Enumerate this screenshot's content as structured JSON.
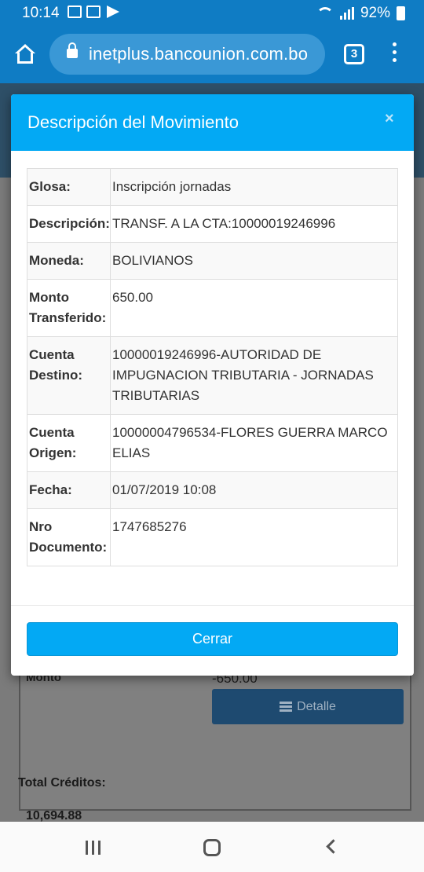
{
  "status_bar": {
    "time": "10:14",
    "battery": "92%",
    "notification_icons": [
      "image-icon",
      "mail-icon",
      "telegram-icon"
    ]
  },
  "browser": {
    "url": "inetplus.bancounion.com.bo",
    "tab_count": "3"
  },
  "modal": {
    "title": "Descripción del Movimiento",
    "close_label": "×",
    "rows": [
      {
        "label": "Glosa:",
        "value": "Inscripción jornadas"
      },
      {
        "label": "Descripción:",
        "value": "TRANSF. A LA CTA:10000019246996"
      },
      {
        "label": "Moneda:",
        "value": "BOLIVIANOS"
      },
      {
        "label": "Monto Transferido:",
        "value": "650.00"
      },
      {
        "label": "Cuenta Destino:",
        "value": "10000019246996-AUTORIDAD DE IMPUGNACION TRIBUTARIA - JORNADAS TRIBUTARIAS"
      },
      {
        "label": "Cuenta Origen:",
        "value": "10000004796534-FLORES GUERRA MARCO ELIAS"
      },
      {
        "label": "Fecha:",
        "value": "01/07/2019 10:08"
      },
      {
        "label": "Nro Documento:",
        "value": "1747685276"
      }
    ],
    "close_button": "Cerrar"
  },
  "background_page": {
    "monto_label": "Monto",
    "monto_value": "-650.00",
    "detalle_button": "Detalle",
    "total_creditos_label": "Total Créditos:",
    "total_creditos_value": "10,694.88"
  },
  "colors": {
    "chrome_blue": "#0f7cc4",
    "modal_header": "#03a9f4",
    "button_blue": "#03a9f4"
  }
}
